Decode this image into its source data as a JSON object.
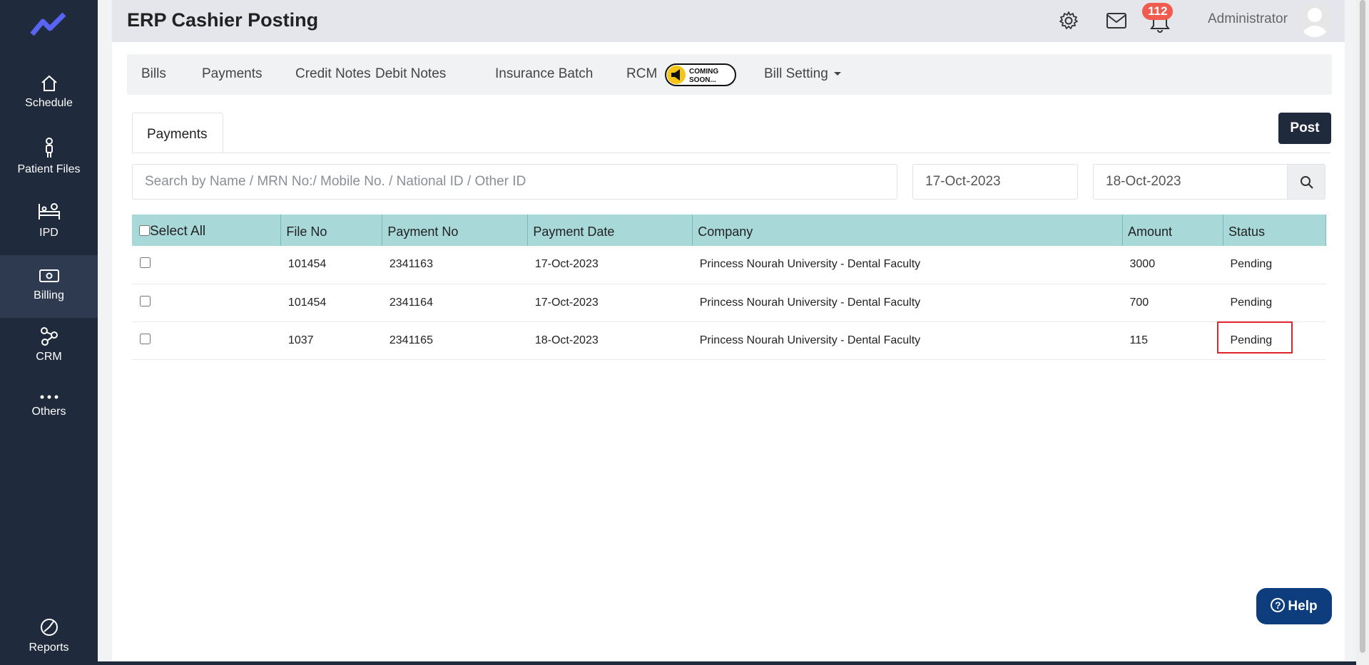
{
  "app": {
    "title": "ERP Cashier Posting",
    "notification_count": "112",
    "user_name": "Administrator"
  },
  "sidebar": {
    "items": [
      {
        "label": "Schedule",
        "icon": "home-icon"
      },
      {
        "label": "Patient Files",
        "icon": "patient-icon"
      },
      {
        "label": "IPD",
        "icon": "bed-icon"
      },
      {
        "label": "Billing",
        "icon": "money-icon",
        "active": true
      },
      {
        "label": "CRM",
        "icon": "network-icon"
      },
      {
        "label": "Others",
        "icon": "more-dots-icon"
      },
      {
        "label": "Reports",
        "icon": "pie-chart-icon"
      }
    ]
  },
  "top_tabs": {
    "items": [
      "Bills",
      "Payments",
      "Credit Notes",
      "Debit Notes",
      "Insurance Batch",
      "RCM",
      "Bill Setting"
    ],
    "coming_soon_line1": "COMING",
    "coming_soon_line2": "SOON..."
  },
  "sub_tab": {
    "label": "Payments"
  },
  "actions": {
    "post_label": "Post",
    "help_label": "Help"
  },
  "search": {
    "placeholder": "Search by Name / MRN No:/ Mobile No. / National ID / Other ID",
    "value": ""
  },
  "date_range": {
    "from": "17-Oct-2023",
    "to": "18-Oct-2023"
  },
  "table": {
    "columns": [
      "Select All",
      "File No",
      "Payment No",
      "Payment Date",
      "Company",
      "Amount",
      "Status"
    ],
    "rows": [
      {
        "file_no": "101454",
        "payment_no": "2341163",
        "payment_date": "17-Oct-2023",
        "company": "Princess Nourah University - Dental Faculty",
        "amount": "3000",
        "status": "Pending"
      },
      {
        "file_no": "101454",
        "payment_no": "2341164",
        "payment_date": "17-Oct-2023",
        "company": "Princess Nourah University - Dental Faculty",
        "amount": "700",
        "status": "Pending"
      },
      {
        "file_no": "1037",
        "payment_no": "2341165",
        "payment_date": "18-Oct-2023",
        "company": "Princess Nourah University - Dental Faculty",
        "amount": "115",
        "status": "Pending"
      }
    ]
  },
  "colors": {
    "sidebar": "#1f2a3c",
    "table_header": "#a8d8d8",
    "badge": "#f05a4f",
    "help_button": "#0d3d7c",
    "highlight": "#e0242b"
  }
}
